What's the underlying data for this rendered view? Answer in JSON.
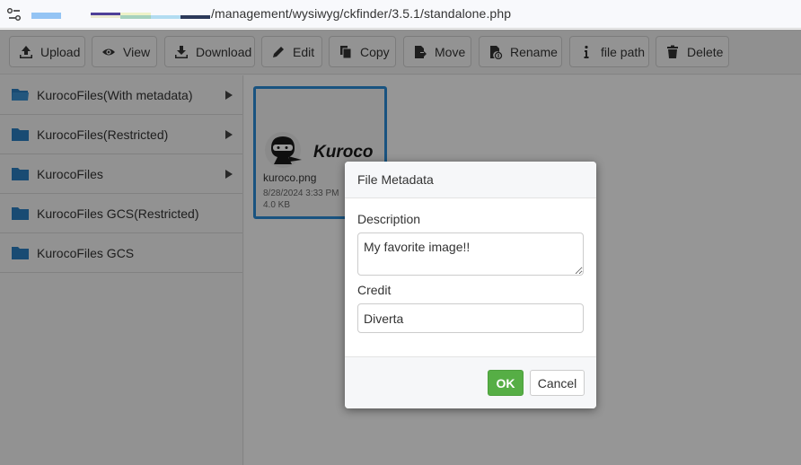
{
  "browser": {
    "url_visible": "/management/wysiwyg/ckfinder/3.5.1/standalone.php",
    "site_icon": "tune-settings-icon"
  },
  "toolbar": {
    "buttons": [
      {
        "label": "Upload",
        "icon": "upload-icon"
      },
      {
        "label": "View",
        "icon": "eye-icon"
      },
      {
        "label": "Download",
        "icon": "download-icon"
      },
      {
        "label": "Edit",
        "icon": "pencil-icon"
      },
      {
        "label": "Copy",
        "icon": "copy-icon"
      },
      {
        "label": "Move",
        "icon": "move-file-icon"
      },
      {
        "label": "Rename",
        "icon": "rename-file-icon"
      },
      {
        "label": "file path",
        "icon": "info-icon"
      },
      {
        "label": "Delete",
        "icon": "trash-icon"
      }
    ]
  },
  "sidebar": {
    "folders": [
      {
        "label": "KurocoFiles(With metadata)",
        "has_children": true,
        "open": true
      },
      {
        "label": "KurocoFiles(Restricted)",
        "has_children": true
      },
      {
        "label": "KurocoFiles",
        "has_children": true
      },
      {
        "label": "KurocoFiles GCS(Restricted)",
        "has_children": false
      },
      {
        "label": "KurocoFiles GCS",
        "has_children": false
      }
    ]
  },
  "files": [
    {
      "name": "kuroco.png",
      "date": "8/28/2024 3:33 PM",
      "size": "4.0 KB",
      "thumb_text": "Kuroco",
      "selected": true
    }
  ],
  "dialog": {
    "title": "File Metadata",
    "description_label": "Description",
    "description_value": "My favorite image!!",
    "credit_label": "Credit",
    "credit_value": "Diverta",
    "ok_label": "OK",
    "cancel_label": "Cancel"
  },
  "colors": {
    "accent": "#2a8ad6",
    "ok_button": "#56ae45",
    "folder": "#2a7ec0"
  }
}
